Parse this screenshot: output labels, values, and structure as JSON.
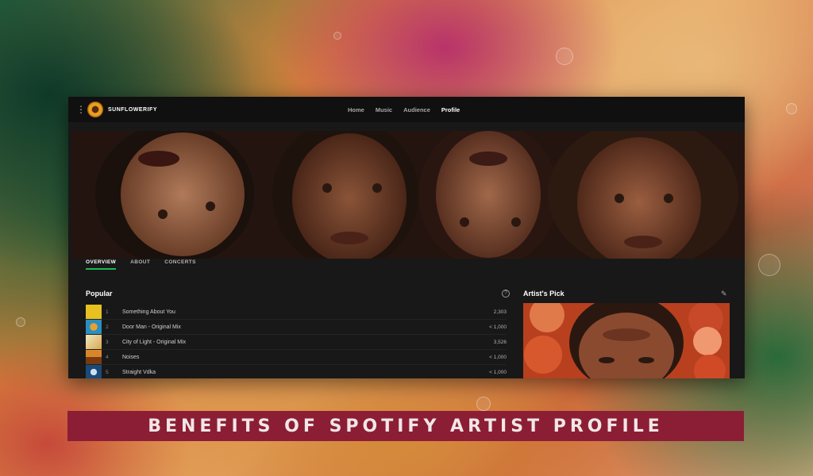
{
  "app": {
    "brand": "SUNFLOWERIFY"
  },
  "nav": {
    "items": [
      "Home",
      "Music",
      "Audience",
      "Profile"
    ],
    "active": "Profile"
  },
  "tabs": {
    "items": [
      "OVERVIEW",
      "ABOUT",
      "CONCERTS"
    ],
    "active": "OVERVIEW"
  },
  "popular": {
    "title": "Popular",
    "tracks": [
      {
        "num": "1",
        "name": "Something About You",
        "plays": "2,303",
        "thumb_color": "#e8c020"
      },
      {
        "num": "2",
        "name": "Door Man - Original Mix",
        "plays": "< 1,000",
        "thumb_color": "#2a8fc0"
      },
      {
        "num": "3",
        "name": "City of Light - Original Mix",
        "plays": "3,526",
        "thumb_color": "#f0e8c0"
      },
      {
        "num": "4",
        "name": "Noises",
        "plays": "< 1,000",
        "thumb_color": "#d8862a"
      },
      {
        "num": "5",
        "name": "Straight Vdka",
        "plays": "< 1,000",
        "thumb_color": "#1a4a7a"
      }
    ]
  },
  "artists_pick": {
    "title": "Artist's Pick"
  },
  "banner": {
    "text": "BENEFITS OF SPOTIFY ARTIST PROFILE"
  },
  "colors": {
    "accent": "#1db954",
    "banner_bg": "#8b1e35",
    "app_bg": "#181818"
  },
  "icons": [
    "kebab-menu-icon",
    "help-icon",
    "edit-pencil-icon"
  ]
}
